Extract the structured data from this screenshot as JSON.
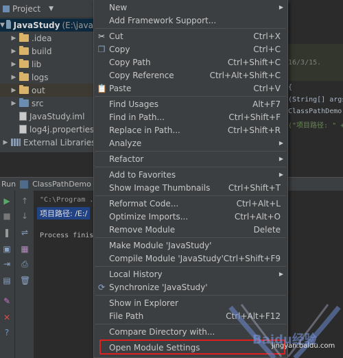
{
  "project_panel": {
    "title": "Project",
    "root": {
      "name": "JavaStudy",
      "path": "(E:\\java\\"
    },
    "items": [
      {
        "label": ".idea",
        "icon": "folder-icon"
      },
      {
        "label": "build",
        "icon": "folder-icon"
      },
      {
        "label": "lib",
        "icon": "folder-icon"
      },
      {
        "label": "logs",
        "icon": "folder-icon"
      },
      {
        "label": "out",
        "icon": "folder-icon"
      },
      {
        "label": "src",
        "icon": "source-folder-icon"
      },
      {
        "label": "JavaStudy.iml",
        "icon": "iml-file-icon"
      },
      {
        "label": "log4j.properties",
        "icon": "properties-file-icon"
      }
    ],
    "external": "External Libraries"
  },
  "editor": {
    "date_fragment": "16/3/15.",
    "code1": "{",
    "code2": "(String[] args",
    "code3": "ClassPathDemo.",
    "code4": "(\"项目路径: \" +"
  },
  "run_panel": {
    "label": "Run",
    "config": "ClassPathDemo",
    "console_lines": [
      "\"C:\\Program ...",
      "项目路径: /E:/",
      "Process finish"
    ]
  },
  "context_menu": {
    "new": "New",
    "add_framework": "Add Framework Support...",
    "cut": "Cut",
    "cut_sc": "Ctrl+X",
    "copy": "Copy",
    "copy_sc": "Ctrl+C",
    "copy_path": "Copy Path",
    "copy_path_sc": "Ctrl+Shift+C",
    "copy_reference": "Copy Reference",
    "copy_reference_sc": "Ctrl+Alt+Shift+C",
    "paste": "Paste",
    "paste_sc": "Ctrl+V",
    "find_usages": "Find Usages",
    "find_usages_sc": "Alt+F7",
    "find_in_path": "Find in Path...",
    "find_in_path_sc": "Ctrl+Shift+F",
    "replace_in_path": "Replace in Path...",
    "replace_in_path_sc": "Ctrl+Shift+R",
    "analyze": "Analyze",
    "refactor": "Refactor",
    "add_to_favorites": "Add to Favorites",
    "show_thumbnails": "Show Image Thumbnails",
    "show_thumbnails_sc": "Ctrl+Shift+T",
    "reformat_code": "Reformat Code...",
    "reformat_code_sc": "Ctrl+Alt+L",
    "optimize_imports": "Optimize Imports...",
    "optimize_imports_sc": "Ctrl+Alt+O",
    "remove_module": "Remove Module",
    "remove_module_sc": "Delete",
    "make_module": "Make Module 'JavaStudy'",
    "compile_module": "Compile Module 'JavaStudy'",
    "compile_module_sc": "Ctrl+Shift+F9",
    "local_history": "Local History",
    "synchronize": "Synchronize 'JavaStudy'",
    "show_in_explorer": "Show in Explorer",
    "file_path": "File Path",
    "file_path_sc": "Ctrl+Alt+F12",
    "compare_directory": "Compare Directory with...",
    "open_module_settings": "Open Module Settings"
  },
  "watermark": {
    "brand": "Baidu经验",
    "url": "jingyan.baidu.com"
  },
  "colors": {
    "menu_bg": "#3c3f41",
    "highlight": "#e0201f",
    "selection": "#0d293e"
  }
}
